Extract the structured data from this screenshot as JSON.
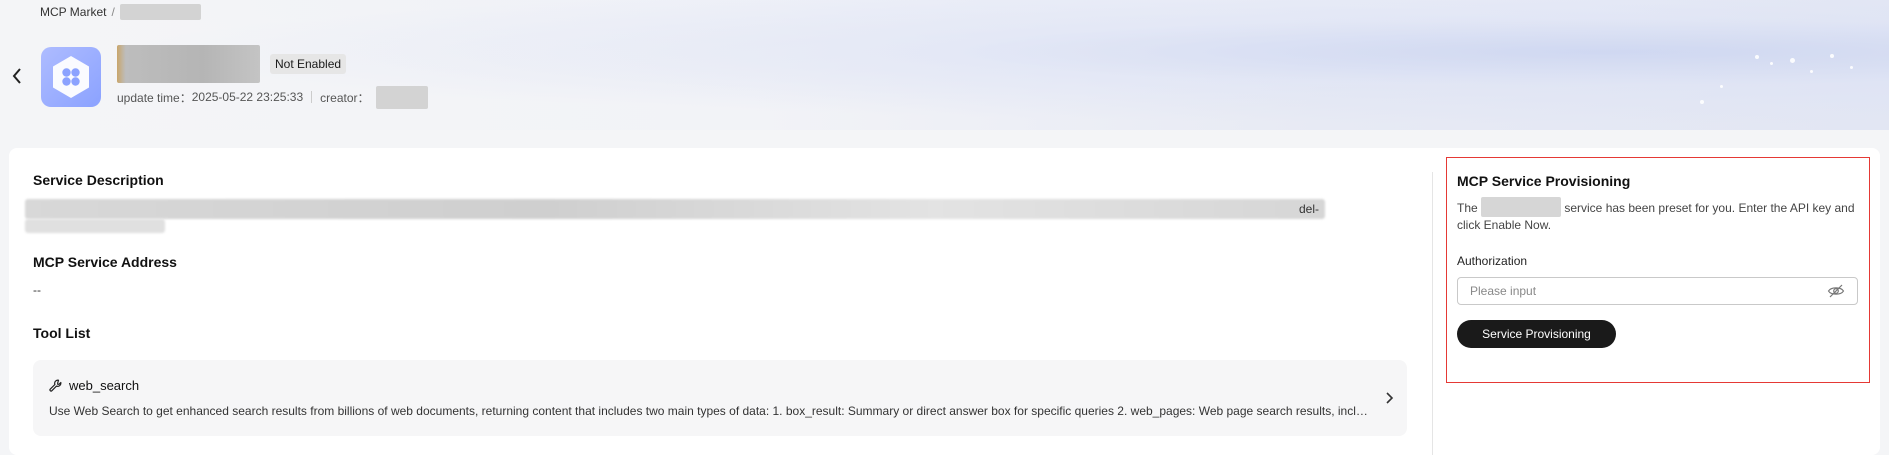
{
  "breadcrumb": {
    "root": "MCP Market",
    "separator": "/"
  },
  "header": {
    "status": "Not Enabled",
    "update_time_label": "update time：",
    "update_time_value": "2025-05-22 23:25:33",
    "creator_label": "creator："
  },
  "main": {
    "service_description_title": "Service Description",
    "service_description_tail": "del-",
    "service_address_title": "MCP Service Address",
    "service_address_value": "--",
    "tool_list_title": "Tool List",
    "tools": [
      {
        "name": "web_search",
        "icon": "wrench-icon",
        "description": "Use Web Search to get enhanced search results from billions of web documents, returning content that includes two main types of data: 1. box_result: Summary or direct answer box for specific queries 2. web_pages: Web page search results, including title, URL and snippet"
      }
    ]
  },
  "provisioning": {
    "title": "MCP Service Provisioning",
    "desc_before": "The ",
    "desc_after": " service has been preset for you. Enter the API key and click Enable Now.",
    "auth_label": "Authorization",
    "auth_placeholder": "Please input",
    "auth_value": "",
    "button_label": "Service Provisioning"
  },
  "colors": {
    "accent": "#1a1a1a",
    "highlight_border": "#e53935",
    "app_icon": "#8ba2ff"
  }
}
